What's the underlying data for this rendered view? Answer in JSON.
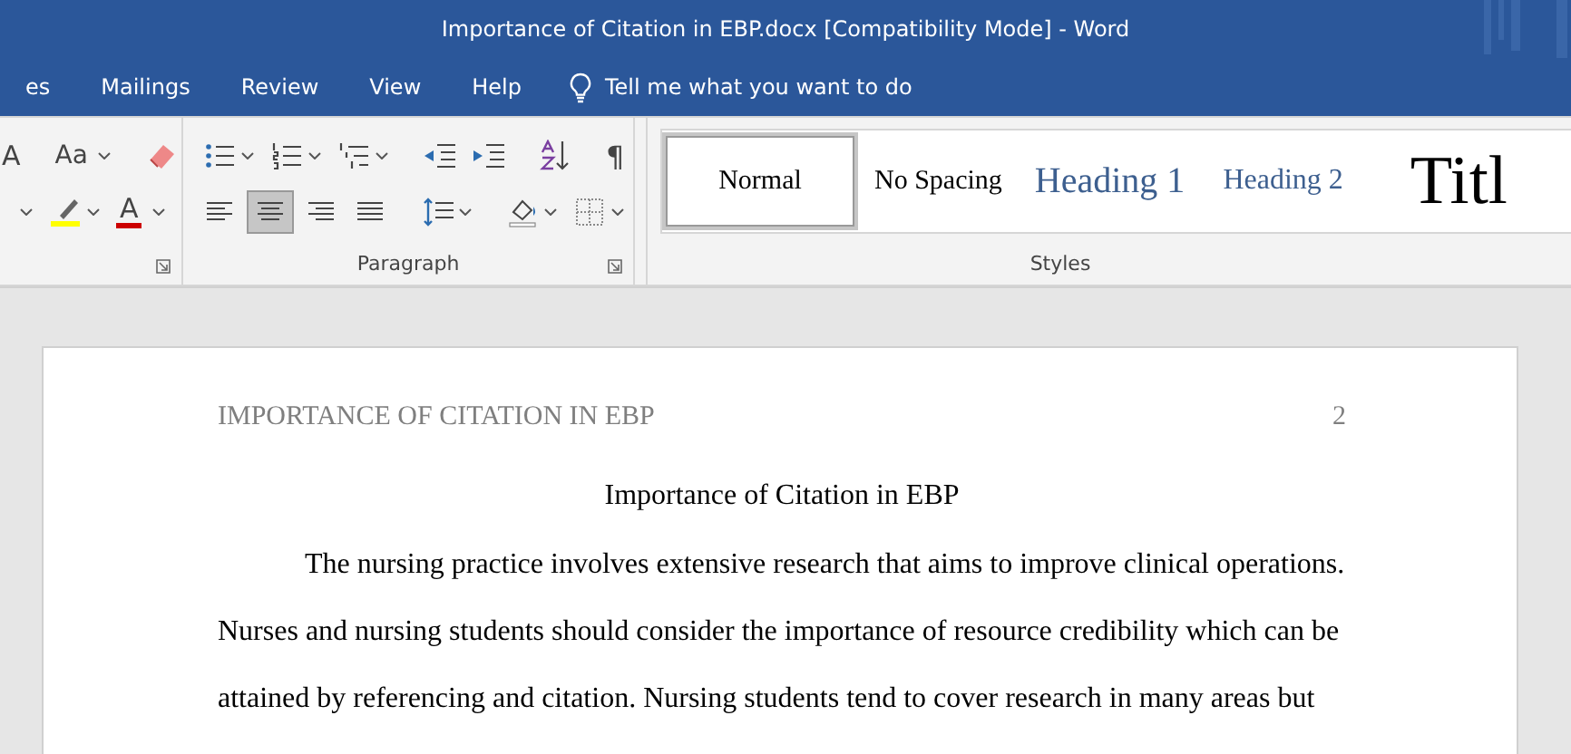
{
  "window": {
    "title": "Importance of Citation in EBP.docx [Compatibility Mode]  -  Word"
  },
  "ribbon_tabs": [
    {
      "label": "es"
    },
    {
      "label": "Mailings"
    },
    {
      "label": "Review"
    },
    {
      "label": "View"
    },
    {
      "label": "Help"
    }
  ],
  "tell_me": {
    "placeholder": "Tell me what you want to do"
  },
  "font_group": {
    "row1": [
      {
        "kind": "grow",
        "glyph": "A"
      },
      {
        "kind": "sep"
      },
      {
        "kind": "case",
        "glyph": "Aa",
        "dropdown": true
      },
      {
        "kind": "sep"
      },
      {
        "kind": "eraser"
      }
    ],
    "row2": [
      {
        "kind": "caret"
      },
      {
        "kind": "highlight",
        "dropdown": true
      },
      {
        "kind": "fontcolor",
        "glyph": "A",
        "dropdown": true
      }
    ]
  },
  "paragraph_group": {
    "label": "Paragraph",
    "row1": [
      {
        "kind": "bullets",
        "dropdown": true
      },
      {
        "kind": "numbering",
        "dropdown": true
      },
      {
        "kind": "multilevel",
        "dropdown": true
      },
      {
        "kind": "sep"
      },
      {
        "kind": "outdent"
      },
      {
        "kind": "indent"
      },
      {
        "kind": "sep"
      },
      {
        "kind": "sort"
      },
      {
        "kind": "sep"
      },
      {
        "kind": "marks",
        "glyph": "¶"
      }
    ],
    "row2": [
      {
        "kind": "alignleft",
        "selected": false
      },
      {
        "kind": "aligncenter",
        "selected": true
      },
      {
        "kind": "alignright",
        "selected": false
      },
      {
        "kind": "justify",
        "selected": false
      },
      {
        "kind": "sep"
      },
      {
        "kind": "spacing",
        "dropdown": true
      },
      {
        "kind": "sep"
      },
      {
        "kind": "shading",
        "dropdown": true
      },
      {
        "kind": "borders",
        "dropdown": true
      }
    ]
  },
  "styles_group": {
    "label": "Styles",
    "styles": [
      {
        "name": "Normal",
        "kind": "normal",
        "selected": true
      },
      {
        "name": "No Spacing",
        "kind": "normal",
        "selected": false
      },
      {
        "name": "Heading 1",
        "kind": "heading1",
        "selected": false
      },
      {
        "name": "Heading 2",
        "kind": "heading2",
        "selected": false
      },
      {
        "name": "Titl",
        "kind": "title",
        "selected": false
      }
    ]
  },
  "document": {
    "header": {
      "running_head": "IMPORTANCE OF CITATION IN EBP",
      "page_number": "2"
    },
    "title": "Importance of Citation in EBP",
    "paragraph": "The nursing practice involves extensive research that aims to improve clinical operations. Nurses and nursing students should consider the importance of resource credibility which can be attained by referencing and citation. Nursing students tend to cover research in many areas but"
  }
}
